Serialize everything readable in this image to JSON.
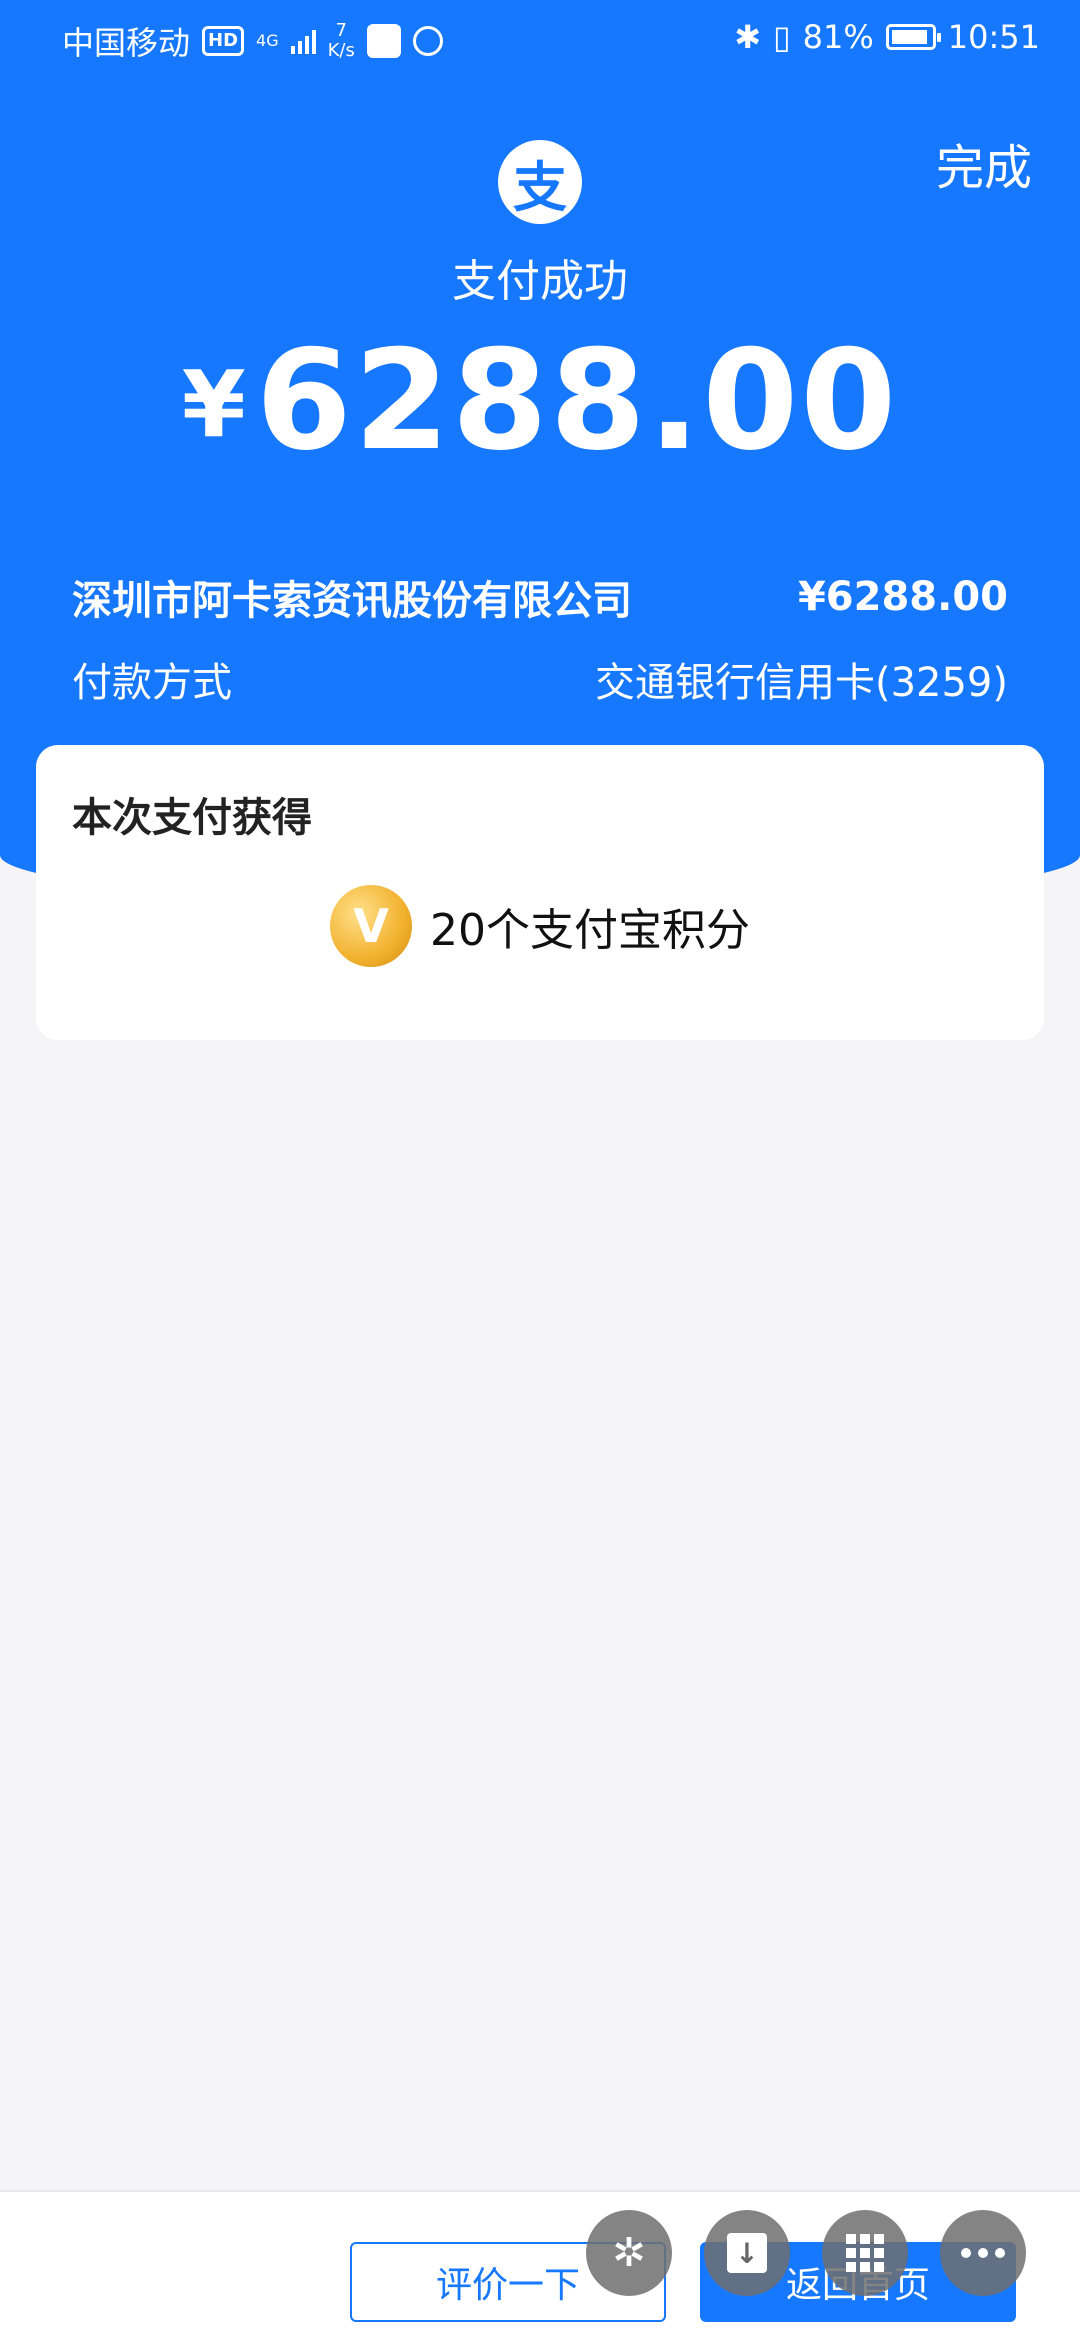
{
  "status_bar": {
    "carrier": "中国移动",
    "hd": "HD",
    "net_type": "4G",
    "speed_value": "7",
    "speed_unit": "K/s",
    "battery": "81%",
    "time": "10:51"
  },
  "header": {
    "done_label": "完成",
    "logo_glyph": "支",
    "status_title": "支付成功",
    "currency_symbol": "¥",
    "amount": "6288.00"
  },
  "details": {
    "merchant": "深圳市阿卡索资讯股份有限公司",
    "merchant_amount": "¥6288.00",
    "method_label": "付款方式",
    "method_value": "交通银行信用卡(3259)"
  },
  "rewards": {
    "title": "本次支付获得",
    "points_text": "20个支付宝积分",
    "coin_glyph": "V"
  },
  "bottom": {
    "rate_label": "评价一下",
    "home_label": "返回首页"
  },
  "floating_icons": [
    "pinwheel-icon",
    "download-icon",
    "grid-icon",
    "more-icon"
  ],
  "colors": {
    "primary": "#1677ff",
    "background": "#f5f5f7",
    "coin": "#f2b12e"
  }
}
